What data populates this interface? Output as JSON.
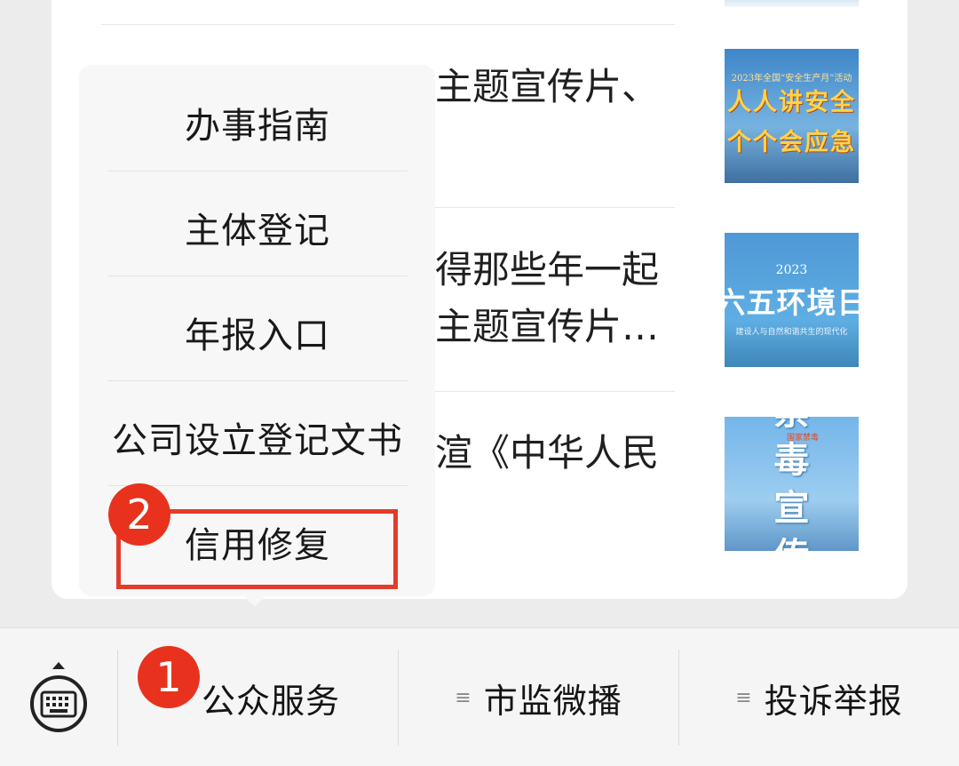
{
  "articles": [
    {
      "line1": "主题宣传片、",
      "line2": ""
    },
    {
      "line1": "得那些年一起",
      "line2": "主题宣传片…"
    },
    {
      "line1": "渲《中华人民",
      "line2": ""
    }
  ],
  "thumbnails": [
    {
      "caption": "2023年全国“安全生产月”活动",
      "line1": "人人讲安全",
      "line2": "个个会应急"
    },
    {
      "year": "2023",
      "title": "六五环境日",
      "sub": "建设人与自然和谐共生的现代化"
    },
    {
      "badge": "国家禁毒",
      "line1": "禁毒",
      "line2": "宣传"
    }
  ],
  "menu": {
    "items": [
      "办事指南",
      "主体登记",
      "年报入口",
      "公司设立登记文书",
      "信用修复"
    ]
  },
  "annotations": {
    "step1": "1",
    "step2": "2",
    "highlight_color": "#e33c2b"
  },
  "bottom_bar": {
    "keyboard_icon": "keyboard-icon",
    "tabs": [
      "公众服务",
      "市监微播",
      "投诉举报"
    ],
    "menu_icon": "≡"
  }
}
